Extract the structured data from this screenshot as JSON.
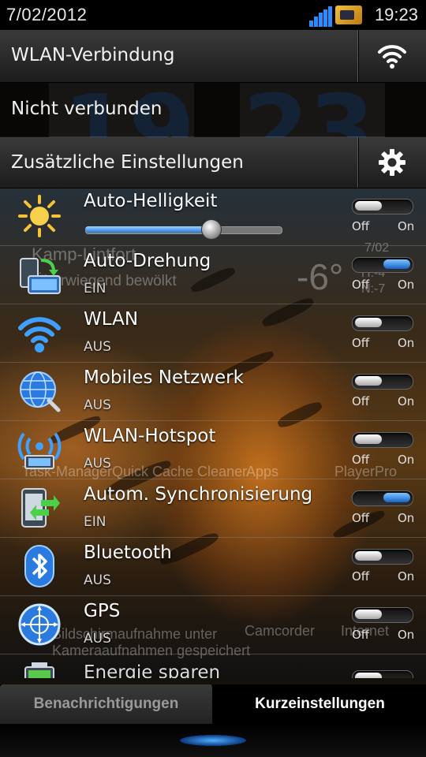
{
  "status_bar": {
    "date": "7/02/2012",
    "time": "19:23"
  },
  "wlan_header": {
    "label": "WLAN-Verbindung",
    "status": "Nicht verbunden"
  },
  "extra_header": {
    "label": "Zusätzliche Einstellungen"
  },
  "rows": [
    {
      "title": "Auto-Helligkeit",
      "subtitle": "",
      "toggle": "off",
      "brightness_level": 0.64
    },
    {
      "title": "Auto-Drehung",
      "subtitle": "EIN",
      "toggle": "on"
    },
    {
      "title": "WLAN",
      "subtitle": "AUS",
      "toggle": "off"
    },
    {
      "title": "Mobiles Netzwerk",
      "subtitle": "AUS",
      "toggle": "off"
    },
    {
      "title": "WLAN-Hotspot",
      "subtitle": "AUS",
      "toggle": "off"
    },
    {
      "title": "Autom. Synchronisierung",
      "subtitle": "EIN",
      "toggle": "on"
    },
    {
      "title": "Bluetooth",
      "subtitle": "AUS",
      "toggle": "off"
    },
    {
      "title": "GPS",
      "subtitle": "AUS",
      "toggle": "off"
    },
    {
      "title": "Energie sparen",
      "subtitle": "",
      "toggle": "off"
    }
  ],
  "toggle_labels": {
    "off": "Off",
    "on": "On"
  },
  "tabs": {
    "notifications": "Benachrichtigungen",
    "quick_settings": "Kurzeinstellungen"
  },
  "background": {
    "clock_hour": "19",
    "clock_minute": "23",
    "weather_location": "Kamp-Lintfort",
    "weather_condition": "Überwiegend bewölkt",
    "weather_temp": "-6°",
    "weather_date": "7/02",
    "weather_hi": "H:-4",
    "weather_lo": "N:-7",
    "app_labels": [
      "Task-Manager",
      "Quick Cache Cleaner",
      "Apps",
      "PlayerPro"
    ],
    "screenshot_note": "Bildschirmaufnahme unter Kameraaufnahmen gespeichert",
    "dock_labels": [
      "Camcorder",
      "Internet"
    ]
  },
  "colors": {
    "accent": "#2a8cff",
    "toggle_on": "#1a62c8"
  }
}
